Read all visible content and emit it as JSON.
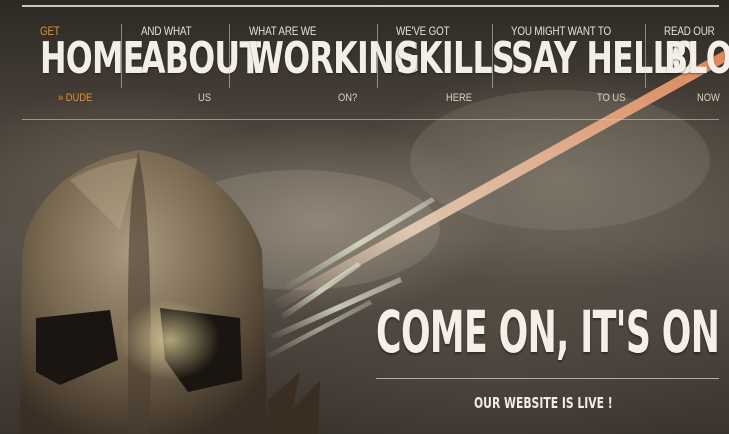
{
  "nav": {
    "items": [
      {
        "pre": "GET",
        "main": "HOME",
        "post": "» DUDE"
      },
      {
        "pre": "AND WHAT",
        "main": "ABOUT",
        "post": "US"
      },
      {
        "pre": "WHAT ARE WE",
        "main": "WORKING",
        "post": "ON?"
      },
      {
        "pre": "WE'VE GOT",
        "main": "SKILLS",
        "post": "HERE"
      },
      {
        "pre": "YOU MIGHT WANT TO",
        "main": "SAY HELLO",
        "post": "TO US"
      },
      {
        "pre": "READ OUR",
        "main": "BLOG",
        "post": "NOW"
      }
    ]
  },
  "hero": {
    "headline": "COME ON, IT'S ON !",
    "subline": "OUR WEBSITE IS LIVE !"
  },
  "colors": {
    "accent": "#e8902e",
    "text": "#f3efe6"
  },
  "icons": [
    "spartan-helmet-illustration",
    "light-beam-streaks"
  ]
}
